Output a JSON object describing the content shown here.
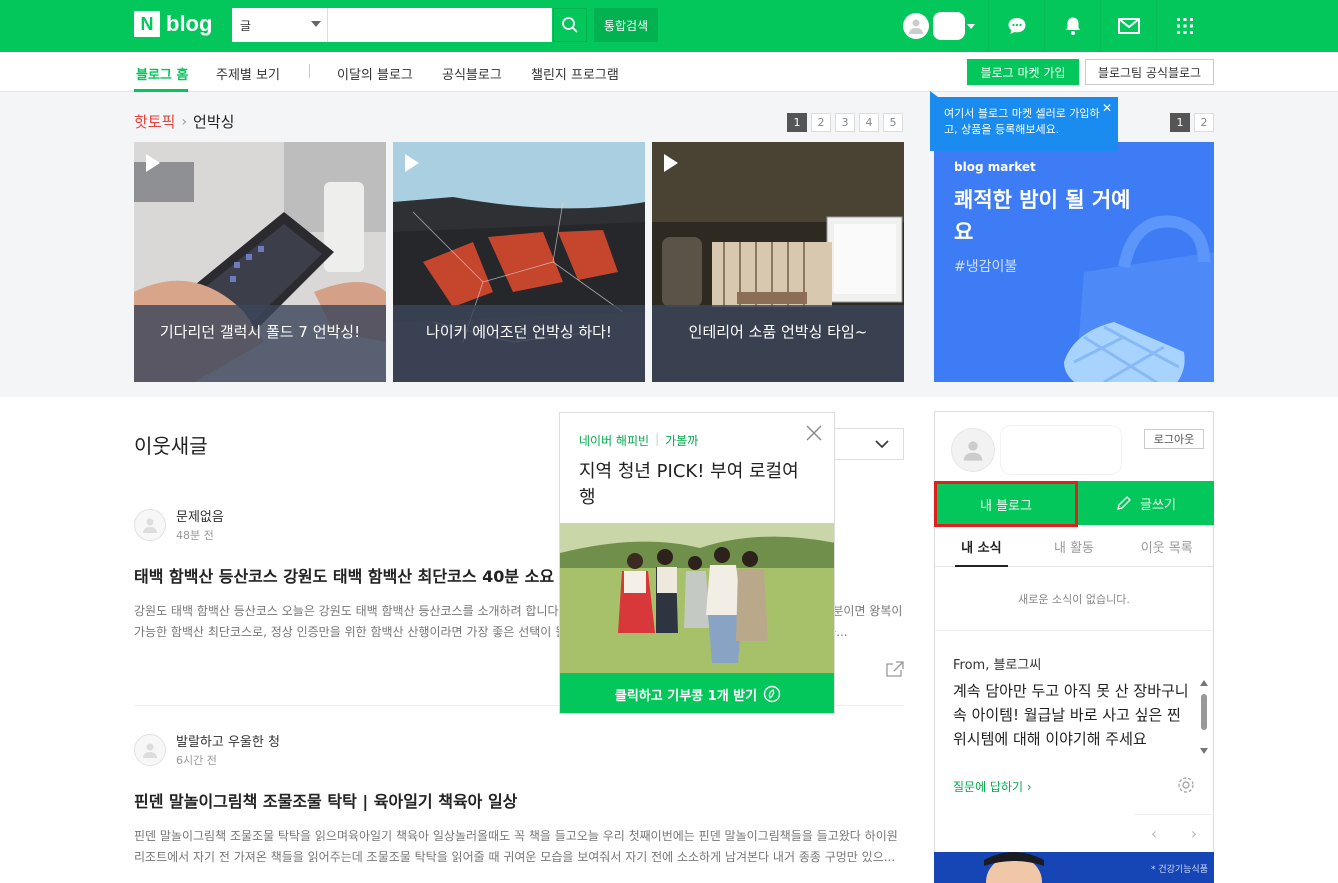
{
  "header": {
    "logo_n": "N",
    "logo_text": "blog",
    "search_type": "글",
    "search_placeholder": "",
    "total_search": "통합검색",
    "icons": [
      "chat-icon",
      "bell-icon",
      "mail-icon",
      "grid-icon"
    ]
  },
  "subnav": {
    "items": [
      "블로그 홈",
      "주제별 보기",
      "이달의 블로그",
      "공식블로그",
      "챌린지 프로그램"
    ],
    "market_join": "블로그 마켓 가입",
    "official_blog": "블로그팀 공식블로그"
  },
  "hot_topic": {
    "label": "핫토픽",
    "topic": "언박싱",
    "pages": [
      "1",
      "2",
      "3",
      "4",
      "5"
    ],
    "cards": [
      {
        "caption": "기다리던 갤럭시 폴드 7 언박싱!"
      },
      {
        "caption": "나이키 에어조던 언박싱 하다!"
      },
      {
        "caption": "인테리어 소품 언박싱 타임~"
      }
    ]
  },
  "market": {
    "tooltip": "여기서 블로그 마켓 셀러로 가입하고, 상품을 등록해보세요.",
    "pages": [
      "1",
      "2"
    ],
    "logo": "blog market",
    "headline": "쾌적한 밤이 될 거예요",
    "tag": "#냉감이불"
  },
  "feed": {
    "title": "이웃새글",
    "posts": [
      {
        "author": "문제없음",
        "time": "48분 전",
        "title": "태백 함백산 등산코스 강원도 태백 함백산 최단코스 40분 소요",
        "body": "강원도 태백 함백산 등산코스 오늘은 강원도 태백 함백산 등산코스를 소개하려 합니다. 함백산 최단코스 만항재에서 출발하는 등산코스는 40분이면 왕복이 가능한 함백산 최단코스로, 정상 인증만을 위한 함백산 산행이라면 가장 좋은 선택이 될 것 같아요. 정상까지 가장 빨리 그리고 가장 쉽게 오를..."
      },
      {
        "author": "발랄하고 우울한 청",
        "time": "6시간 전",
        "title": "핀덴 말놀이그림책 조물조물 탁탁 | 육아일기 책육아 일상",
        "body": "핀덴 말놀이그림책 조물조물 탁탁을 읽으며육아일기 책육아 일상놀러올때도 꼭 책을 들고오늘 우리 첫째이번에는 핀덴 말놀이그림책들을 들고왔다 하이원리조트에서 자기 전 가져온 책들을 읽어주는데 조물조물 탁탁을 읽어줄 때 귀여운 모습을 보여줘서 자기 전에 소소하게 남겨본다 내거 종종 구멍만 있으..."
      }
    ]
  },
  "ad": {
    "brand": "네이버 해피빈",
    "brand2": "가볼까",
    "headline": "지역 청년 PICK! 부여 로컬여행",
    "cta": "클릭하고 기부콩 1개 받기"
  },
  "profile": {
    "logout": "로그아웃",
    "my_blog": "내 블로그",
    "write": "글쓰기",
    "tabs": [
      "내 소식",
      "내 활동",
      "이웃 목록"
    ],
    "empty_news": "새로운 소식이 없습니다.",
    "question_from": "From, 블로그씨",
    "question": "계속 담아만 두고 아직 못 산 장바구니 속 아이템! 월급날 바로 사고 싶은 찐 위시템에 대해 이야기해 주세요",
    "answer": "질문에 답하기",
    "bottom_ad_note": "* 건강기능식품"
  },
  "colors": {
    "brand_green": "#03c75a",
    "hot_red": "#e8403c",
    "market_blue": "#3d7cf4",
    "tooltip_blue": "#1a8cf0",
    "highlight_red": "#e0201c"
  }
}
